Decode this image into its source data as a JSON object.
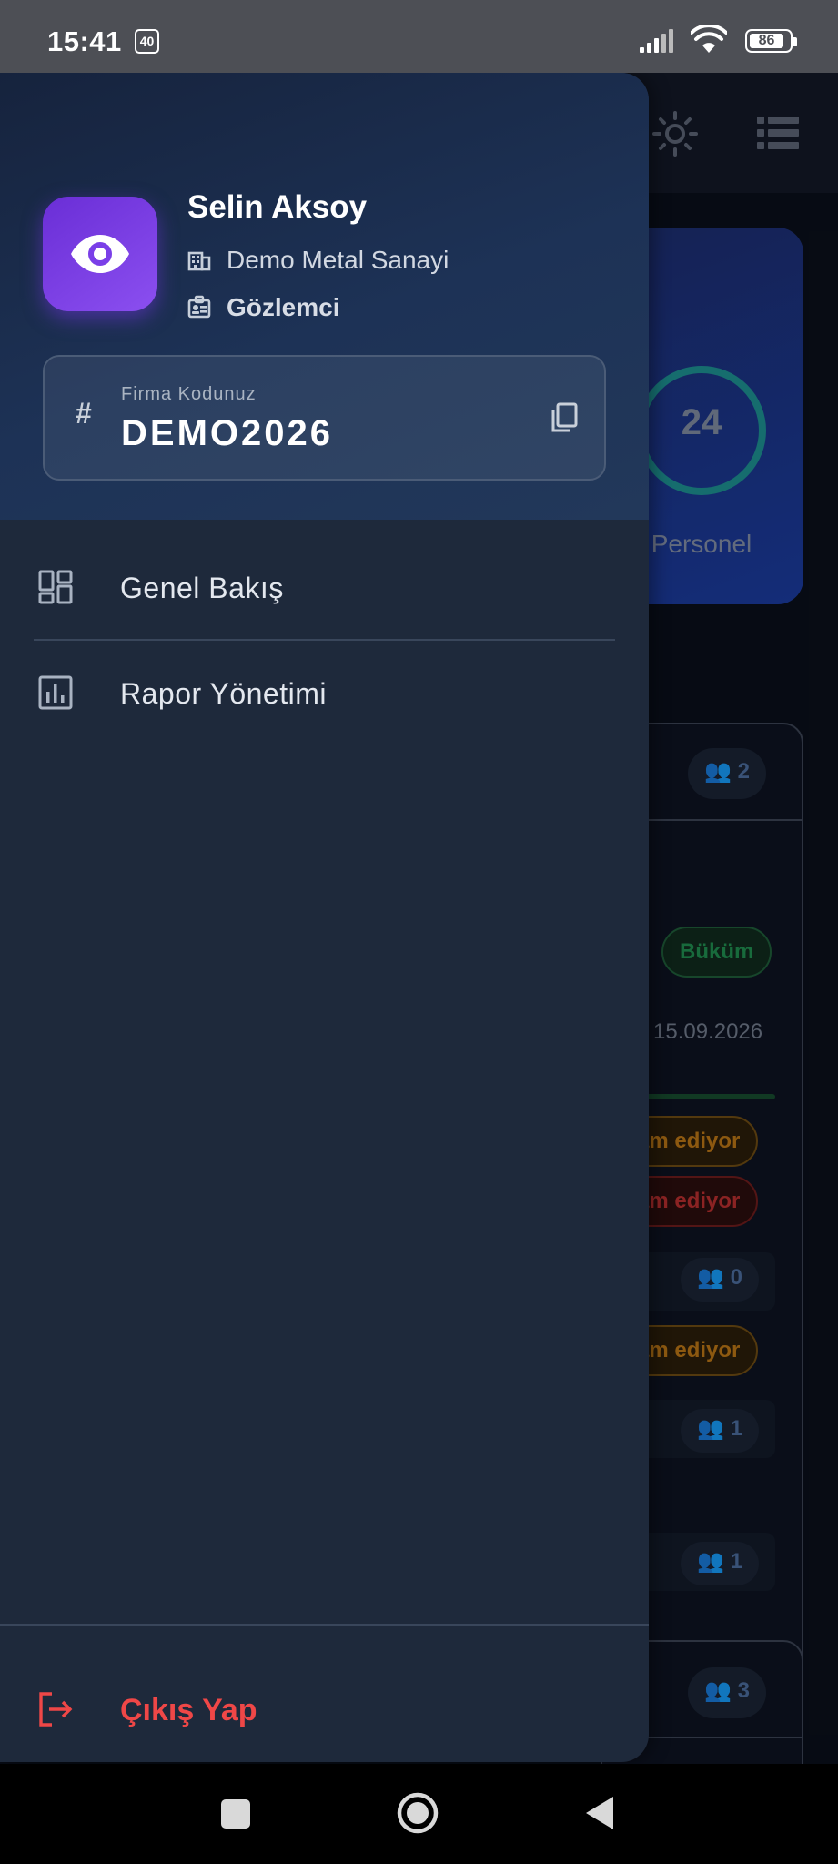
{
  "status_bar": {
    "time": "15:41",
    "notification_badge": "40",
    "battery_level": "86"
  },
  "background": {
    "stat_value": "24",
    "stat_label": "Personel",
    "chips": {
      "people_1": "2",
      "tag_green": "Büküm",
      "amber_1": "am ediyor",
      "red_1": "am ediyor",
      "people_2": "0",
      "amber_2": "am ediyor",
      "people_3": "1",
      "people_4": "1",
      "people_5": "3"
    },
    "date": "15.09.2026"
  },
  "drawer": {
    "user": {
      "name": "Selin Aksoy",
      "company": "Demo Metal Sanayi",
      "role": "Gözlemci"
    },
    "company_code": {
      "label": "Firma Kodunuz",
      "value": "DEMO2026"
    },
    "menu": [
      {
        "label": "Genel Bakış",
        "icon": "dashboard-icon"
      },
      {
        "label": "Rapor Yönetimi",
        "icon": "bar-chart-icon"
      }
    ],
    "logout_label": "Çıkış Yap"
  },
  "colors": {
    "drawer_bg": "#1e293b",
    "avatar_accent": "#7c3aed",
    "logout_red": "#ef4747",
    "header_gradient_start": "#16233d",
    "header_gradient_end": "#22385a"
  }
}
